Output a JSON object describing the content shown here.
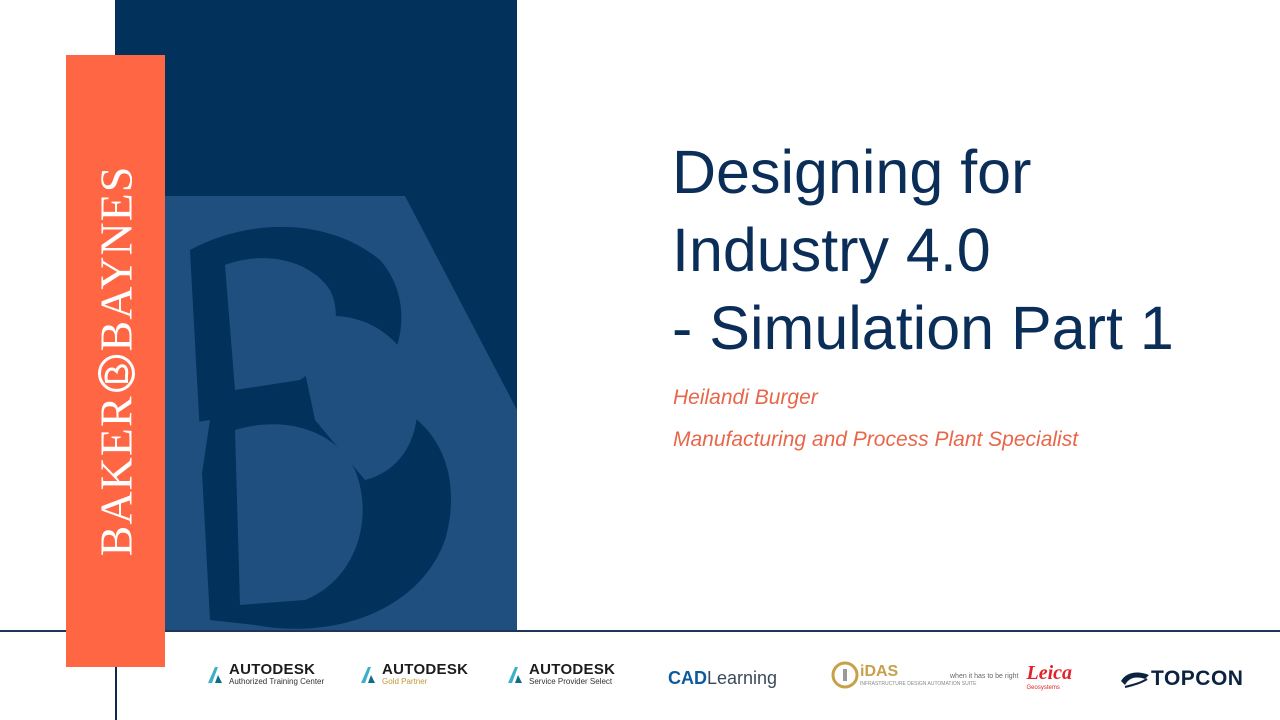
{
  "brand": {
    "name": "BAKER",
    "name2": "BAYNES",
    "colors": {
      "orange": "#ff6644",
      "navy": "#02315b"
    }
  },
  "slide": {
    "title_lines": [
      "Designing for",
      "Industry 4.0",
      "- Simulation Part 1"
    ],
    "presenter_name": "Heilandi Burger",
    "presenter_role": "Manufacturing and Process Plant Specialist"
  },
  "footer": {
    "logos": [
      {
        "name": "AUTODESK",
        "sub": "Authorized Training Center",
        "icon": "autodesk-icon"
      },
      {
        "name": "AUTODESK",
        "sub": "Gold Partner",
        "icon": "autodesk-icon"
      },
      {
        "name": "AUTODESK",
        "sub": "Service Provider Select",
        "icon": "autodesk-icon"
      },
      {
        "name": "CADLearning",
        "prefix": "CAD",
        "suffix": "Learning"
      },
      {
        "name": "iDAS",
        "sub": "INFRASTRUCTURE DESIGN AUTOMATION SUITE"
      },
      {
        "name": "Leica",
        "sub": "Geosystems",
        "tagline": "when it has to be right"
      },
      {
        "name": "TOPCON",
        "icon": "topcon-icon"
      }
    ]
  }
}
